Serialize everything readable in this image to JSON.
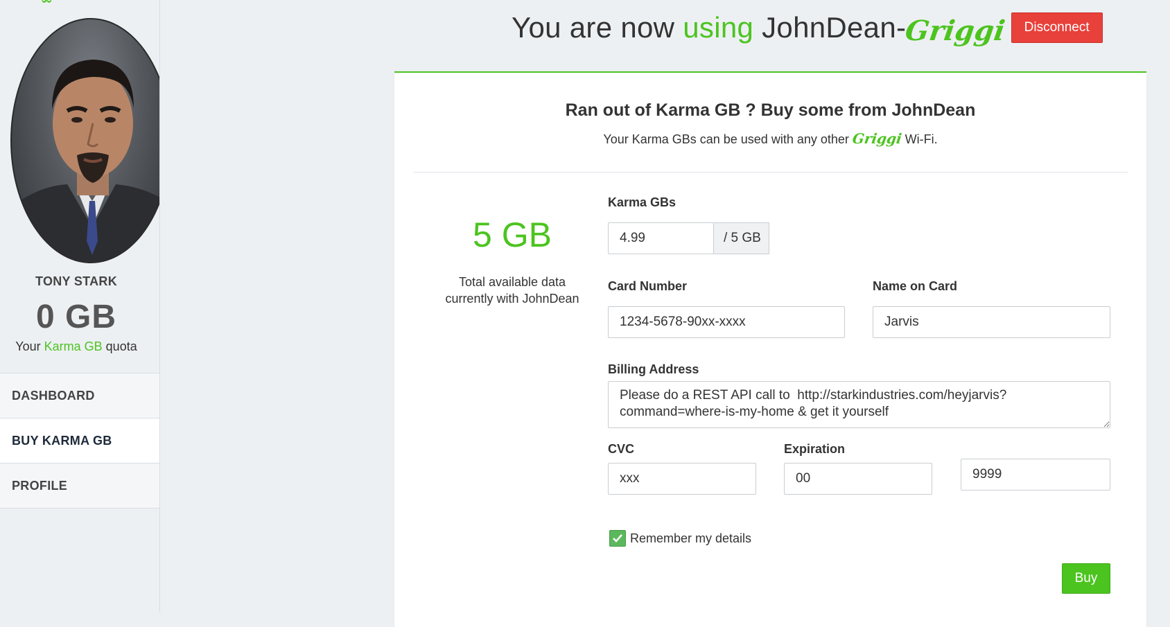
{
  "sidebar": {
    "user_name": "TONY STARK",
    "quota_value": "0 GB",
    "quota_caption_prefix": "Your ",
    "quota_caption_highlight": "Karma GB",
    "quota_caption_suffix": " quota",
    "nav": [
      {
        "label": "DASHBOARD"
      },
      {
        "label": "BUY KARMA GB"
      },
      {
        "label": "PROFILE"
      }
    ]
  },
  "header": {
    "prefix": "You are now ",
    "highlight": "using",
    "network": " JohnDean-",
    "brand": "Griggi",
    "disconnect_label": "Disconnect"
  },
  "card": {
    "title": "Ran out of Karma GB ? Buy some from JohnDean",
    "sub_prefix": "Your Karma GBs can be used with any other ",
    "sub_brand": "Griggi",
    "sub_suffix": " Wi-Fi.",
    "total_amount": "5 GB",
    "total_caption_line1": "Total available data",
    "total_caption_line2": "currently with JohnDean"
  },
  "form": {
    "karma_label": "Karma GBs",
    "karma_value": "4.99",
    "karma_addon": "/ 5 GB",
    "card_number_label": "Card Number",
    "card_number_value": "1234-5678-90xx-xxxx",
    "name_label": "Name on Card",
    "name_value": "Jarvis",
    "billing_label": "Billing Address",
    "billing_value": "Please do a REST API call to  http://starkindustries.com/heyjarvis?command=where-is-my-home & get it yourself",
    "cvc_label": "CVC",
    "cvc_value": "xxx",
    "expiration_label": "Expiration",
    "exp_month_value": "00",
    "exp_year_value": "9999",
    "remember_label": "Remember my details",
    "remember_checked": true,
    "buy_label": "Buy"
  },
  "colors": {
    "accent": "#4cc41f",
    "danger": "#e8403a",
    "background": "#edf0f3"
  }
}
